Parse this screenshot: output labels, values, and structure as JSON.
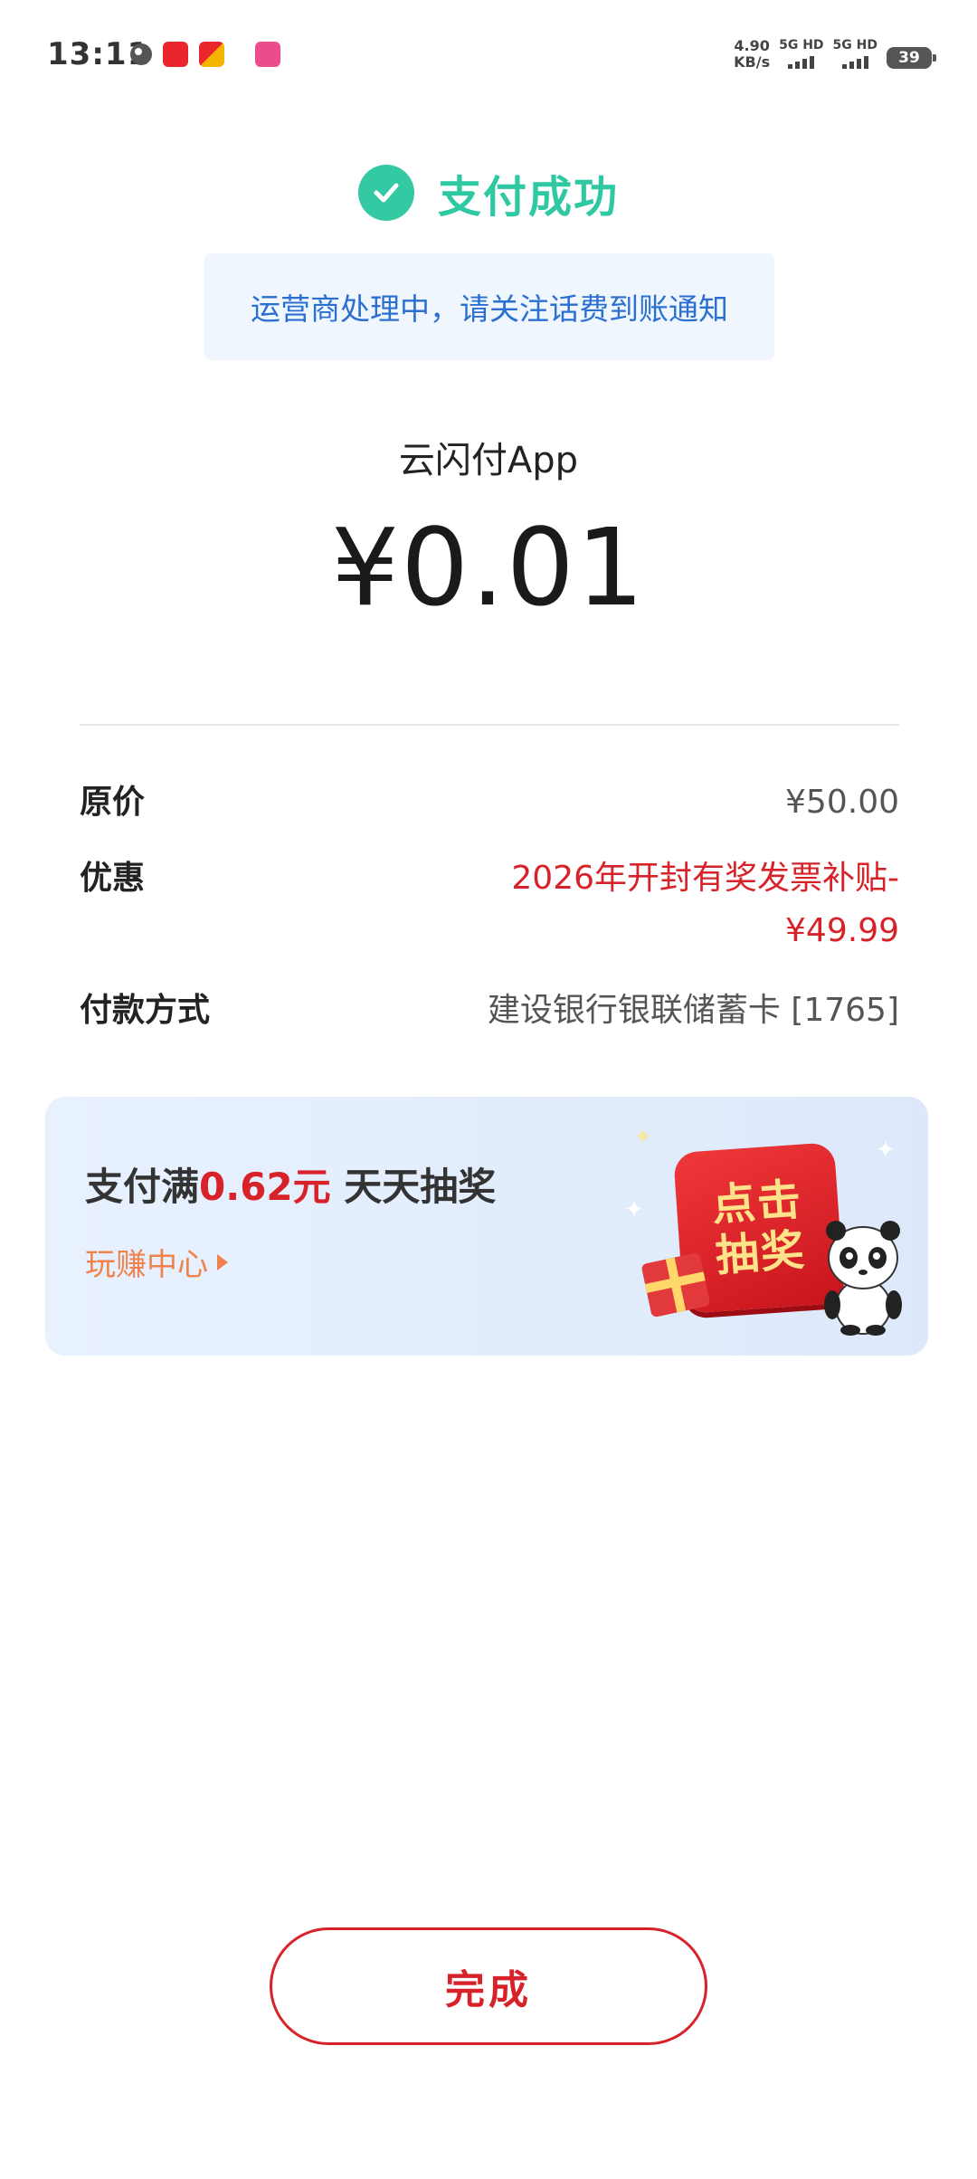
{
  "status_bar": {
    "time": "13:11",
    "net_speed_value": "4.90",
    "net_speed_unit": "KB/s",
    "sim1_label": "5G HD",
    "sim2_label": "5G HD",
    "battery": "39"
  },
  "header": {
    "title": "支付成功",
    "notice": "运营商处理中，请关注话费到账通知"
  },
  "payment": {
    "merchant": "云闪付App",
    "amount": "¥0.01"
  },
  "details": {
    "original_price_label": "原价",
    "original_price_value": "¥50.00",
    "discount_label": "优惠",
    "discount_value_line1": "2026年开封有奖发票补贴-",
    "discount_value_line2": "¥49.99",
    "payment_method_label": "付款方式",
    "payment_method_value": "建设银行银联储蓄卡 [1765]"
  },
  "promo": {
    "title_prefix": "支付满",
    "title_amount": "0.62元",
    "title_suffix": " 天天抽奖",
    "link_label": "玩赚中心",
    "button_line1": "点击",
    "button_line2": "抽奖"
  },
  "footer": {
    "done_label": "完成"
  },
  "colors": {
    "success_green": "#2ec8a2",
    "notice_blue": "#2b6fd1",
    "accent_red": "#d8222a",
    "link_orange": "#f0824b"
  }
}
